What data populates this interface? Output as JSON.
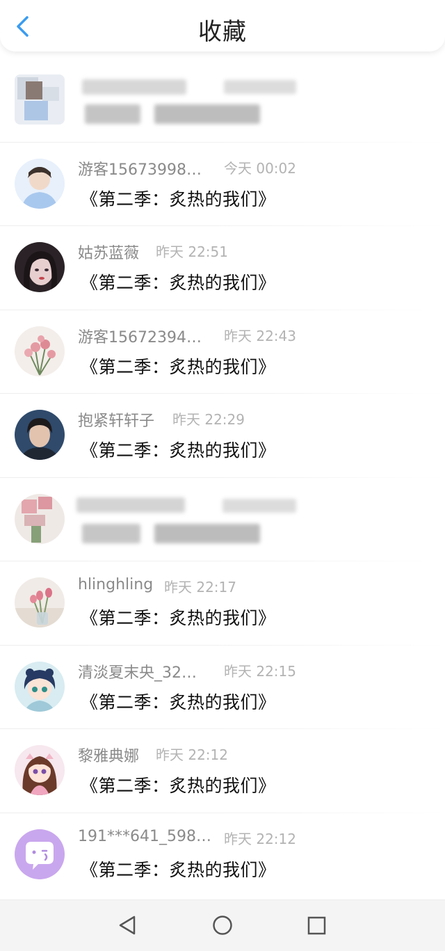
{
  "header": {
    "title": "收藏",
    "back_icon": "chevron-left-icon",
    "accent": "#3a9cf0"
  },
  "items": [
    {
      "blurred": true,
      "avatar": "blurred-portrait-avatar",
      "name": "",
      "time": "",
      "message": ""
    },
    {
      "blurred": false,
      "avatar": "boy-portrait-avatar",
      "name": "游客15673998…",
      "time": "今天 00:02",
      "message": "《第二季：炙热的我们》"
    },
    {
      "blurred": false,
      "avatar": "girl-portrait-avatar",
      "name": "姑苏蓝薇",
      "time": "昨天 22:51",
      "message": "《第二季：炙热的我们》"
    },
    {
      "blurred": false,
      "avatar": "pink-flowers-avatar",
      "name": "游客15672394…",
      "time": "昨天 22:43",
      "message": "《第二季：炙热的我们》"
    },
    {
      "blurred": false,
      "avatar": "young-man-portrait-avatar",
      "name": "抱紧轩轩子",
      "time": "昨天 22:29",
      "message": "《第二季：炙热的我们》"
    },
    {
      "blurred": true,
      "avatar": "blurred-flowers-avatar",
      "name": "",
      "time": "",
      "message": ""
    },
    {
      "blurred": false,
      "avatar": "tulip-vase-avatar",
      "name": "hlinghling",
      "time": "昨天 22:17",
      "message": "《第二季：炙热的我们》"
    },
    {
      "blurred": false,
      "avatar": "anime-girl-avatar",
      "name": "清淡夏末央_32…",
      "time": "昨天 22:15",
      "message": "《第二季：炙热的我们》"
    },
    {
      "blurred": false,
      "avatar": "cartoon-girl-avatar",
      "name": "黎雅典娜",
      "time": "昨天 22:12",
      "message": "《第二季：炙热的我们》"
    },
    {
      "blurred": false,
      "avatar": "chat-bubble-avatar",
      "name": "191***641_598…",
      "time": "昨天 22:12",
      "message": "《第二季：炙热的我们》"
    }
  ],
  "navbar": {
    "back": "triangle-back-icon",
    "home": "circle-home-icon",
    "recents": "square-recents-icon"
  }
}
